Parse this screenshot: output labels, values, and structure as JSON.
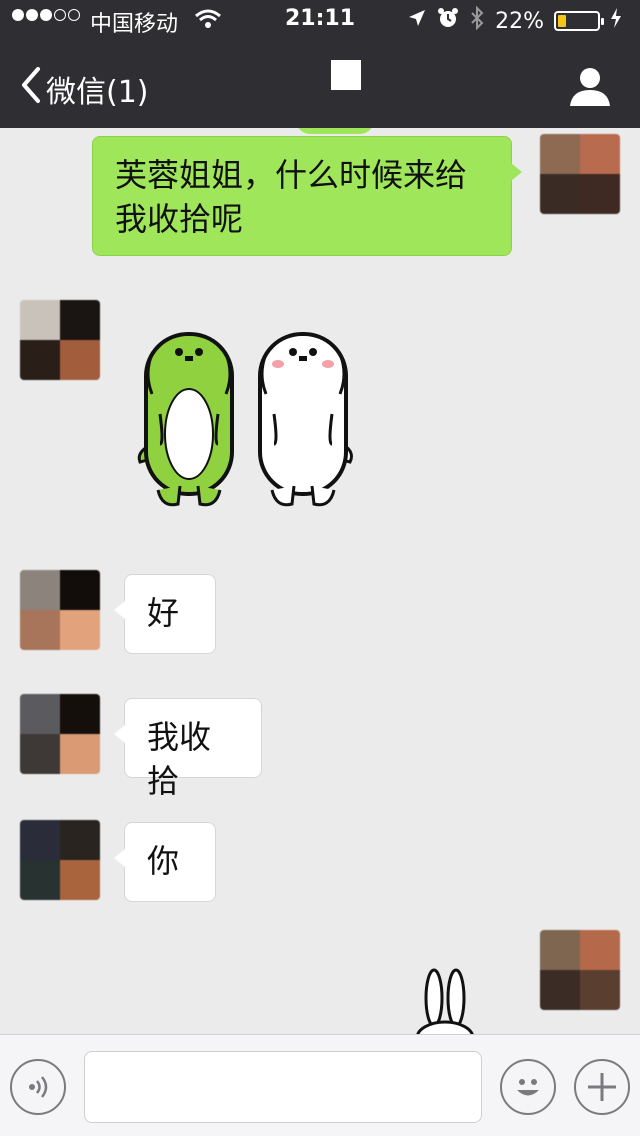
{
  "status_bar": {
    "carrier": "中国移动",
    "time": "21:11",
    "battery_percent": "22%",
    "battery_level": 0.22,
    "signal_bars_filled": 3,
    "signal_bars_total": 5,
    "icons": [
      "wifi-icon",
      "location-arrow-icon",
      "alarm-icon",
      "bluetooth-icon",
      "battery-icon",
      "charging-bolt-icon"
    ]
  },
  "nav": {
    "back_label": "微信(1)",
    "icons": [
      "back-chevron-icon",
      "profile-icon"
    ]
  },
  "messages": [
    {
      "side": "me",
      "type": "text",
      "text": "芙蓉姐姐，什么时候来给我收拾呢"
    },
    {
      "side": "other",
      "type": "sticker",
      "sticker": "green-and-white-dogs-sticker"
    },
    {
      "side": "other",
      "type": "text",
      "text": "好"
    },
    {
      "side": "other",
      "type": "text",
      "text": "我收拾"
    },
    {
      "side": "other",
      "type": "text",
      "text": "你"
    },
    {
      "side": "me",
      "type": "sticker",
      "sticker": "white-rabbit-sticker"
    }
  ],
  "input_bar": {
    "value": "",
    "icons": [
      "voice-icon",
      "emoji-icon",
      "plus-icon"
    ]
  },
  "colors": {
    "nav_bg": "#2f2f33",
    "chat_bg": "#ebebeb",
    "my_bubble": "#9fe65b",
    "other_bubble": "#ffffff",
    "battery_fill": "#f5c518"
  }
}
